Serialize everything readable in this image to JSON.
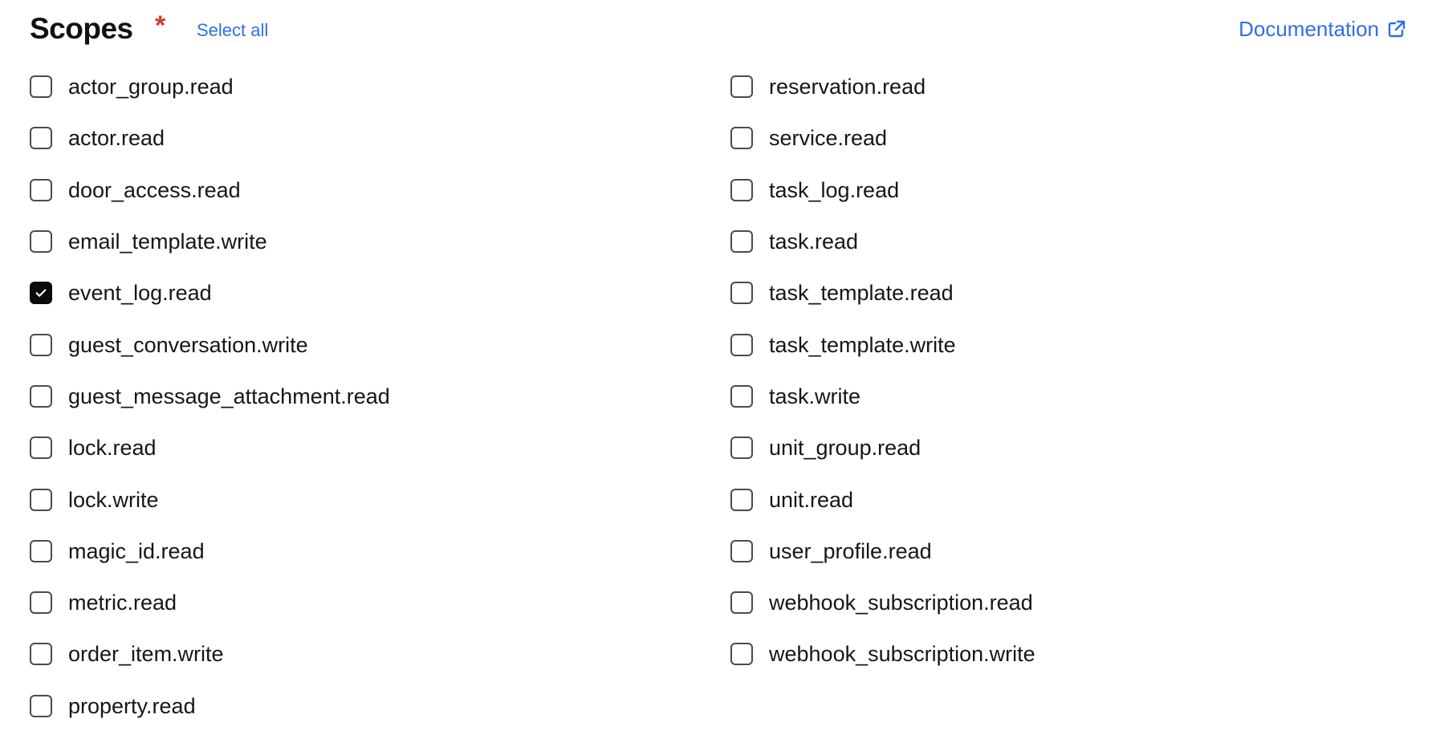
{
  "header": {
    "title": "Scopes",
    "required_marker": "*",
    "select_all_label": "Select all",
    "documentation_label": "Documentation"
  },
  "colors": {
    "link": "#2f6ee8",
    "required": "#d83a2c",
    "checkbox_checked": "#0b0b0b"
  },
  "icons": {
    "documentation": "external-link-icon",
    "checked": "checkmark-icon"
  },
  "scopes": {
    "left": [
      {
        "label": "actor_group.read",
        "checked": false
      },
      {
        "label": "actor.read",
        "checked": false
      },
      {
        "label": "door_access.read",
        "checked": false
      },
      {
        "label": "email_template.write",
        "checked": false
      },
      {
        "label": "event_log.read",
        "checked": true
      },
      {
        "label": "guest_conversation.write",
        "checked": false
      },
      {
        "label": "guest_message_attachment.read",
        "checked": false
      },
      {
        "label": "lock.read",
        "checked": false
      },
      {
        "label": "lock.write",
        "checked": false
      },
      {
        "label": "magic_id.read",
        "checked": false
      },
      {
        "label": "metric.read",
        "checked": false
      },
      {
        "label": "order_item.write",
        "checked": false
      },
      {
        "label": "property.read",
        "checked": false
      }
    ],
    "right": [
      {
        "label": "reservation.read",
        "checked": false
      },
      {
        "label": "service.read",
        "checked": false
      },
      {
        "label": "task_log.read",
        "checked": false
      },
      {
        "label": "task.read",
        "checked": false
      },
      {
        "label": "task_template.read",
        "checked": false
      },
      {
        "label": "task_template.write",
        "checked": false
      },
      {
        "label": "task.write",
        "checked": false
      },
      {
        "label": "unit_group.read",
        "checked": false
      },
      {
        "label": "unit.read",
        "checked": false
      },
      {
        "label": "user_profile.read",
        "checked": false
      },
      {
        "label": "webhook_subscription.read",
        "checked": false
      },
      {
        "label": "webhook_subscription.write",
        "checked": false
      }
    ]
  }
}
